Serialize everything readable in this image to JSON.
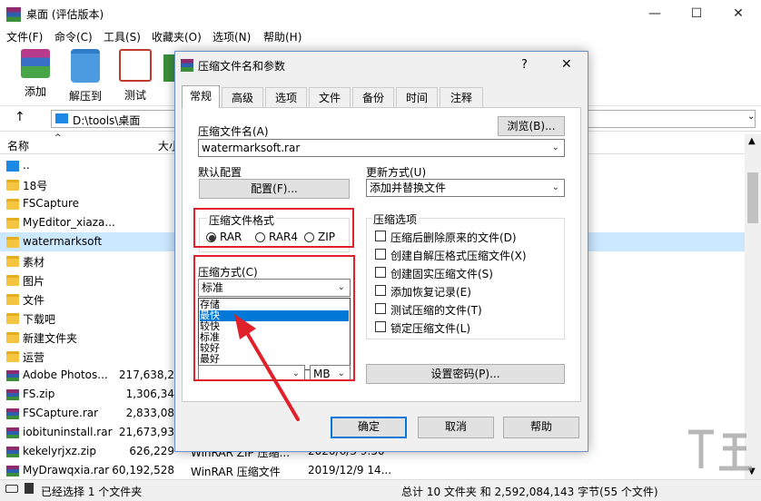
{
  "window": {
    "title": "桌面 (评估版本)",
    "controls": [
      "—",
      "☐",
      "✕"
    ]
  },
  "menu": [
    "文件(F)",
    "命令(C)",
    "工具(S)",
    "收藏夹(O)",
    "选项(N)",
    "帮助(H)"
  ],
  "toolbar": [
    "添加",
    "解压到",
    "测试"
  ],
  "address": "D:\\tools\\桌面",
  "columns": {
    "name": "名称",
    "size": "大小"
  },
  "files": [
    {
      "name": "..",
      "icon": "drive",
      "size": "",
      "type": "",
      "date": ""
    },
    {
      "name": "18号",
      "icon": "folder",
      "size": "",
      "type": "",
      "date": ""
    },
    {
      "name": "FSCapture",
      "icon": "folder",
      "size": "",
      "type": "",
      "date": ""
    },
    {
      "name": "MyEditor_xiaza...",
      "icon": "folder",
      "size": "",
      "type": "",
      "date": ""
    },
    {
      "name": "watermarksoft",
      "icon": "folder-selected",
      "size": "",
      "type": "",
      "date": ""
    },
    {
      "name": "素材",
      "icon": "folder",
      "size": "",
      "type": "",
      "date": ""
    },
    {
      "name": "图片",
      "icon": "folder",
      "size": "",
      "type": "",
      "date": ""
    },
    {
      "name": "文件",
      "icon": "folder",
      "size": "",
      "type": "",
      "date": ""
    },
    {
      "name": "下载吧",
      "icon": "folder",
      "size": "",
      "type": "",
      "date": ""
    },
    {
      "name": "新建文件夹",
      "icon": "folder",
      "size": "",
      "type": "",
      "date": ""
    },
    {
      "name": "运营",
      "icon": "folder",
      "size": "",
      "type": "",
      "date": ""
    },
    {
      "name": "Adobe Photos...",
      "icon": "rar",
      "size": "217,638,2",
      "type": "",
      "date": ""
    },
    {
      "name": "FS.zip",
      "icon": "rar",
      "size": "1,306,34",
      "type": "",
      "date": ""
    },
    {
      "name": "FSCapture.rar",
      "icon": "rar",
      "size": "2,833,08",
      "type": "",
      "date": ""
    },
    {
      "name": "iobituninstall.rar",
      "icon": "rar",
      "size": "21,673,93",
      "type": "",
      "date": ""
    },
    {
      "name": "kekelyrjxz.zip",
      "icon": "rar",
      "size": "626,229",
      "type": "WinRAR ZIP 压缩...",
      "date": "2020/6/3 9:50"
    },
    {
      "name": "MyDrawqxia.rar",
      "icon": "rar",
      "size": "60,192,528",
      "type": "WinRAR 压缩文件",
      "date": "2019/12/9 14..."
    }
  ],
  "status": {
    "left": "已经选择 1 个文件夹",
    "right": "总计 10 文件夹 和 2,592,084,143 字节(55 个文件)"
  },
  "dialog": {
    "title": "压缩文件名和参数",
    "help": "?",
    "close": "✕",
    "tabs": [
      "常规",
      "高级",
      "选项",
      "文件",
      "备份",
      "时间",
      "注释"
    ],
    "archive_name_label": "压缩文件名(A)",
    "browse": "浏览(B)...",
    "archive_name": "watermarksoft.rar",
    "default_profile_label": "默认配置",
    "profile_button": "配置(F)...",
    "update_mode_label": "更新方式(U)",
    "update_mode": "添加并替换文件",
    "format_label": "压缩文件格式",
    "formats": [
      "RAR",
      "RAR4",
      "ZIP"
    ],
    "method_label": "压缩方式(C)",
    "method_value": "标准",
    "method_options": [
      "存储",
      "最快",
      "较快",
      "标准",
      "较好",
      "最好"
    ],
    "split_unit": "MB",
    "options_label": "压缩选项",
    "options": [
      "压缩后删除原来的文件(D)",
      "创建自解压格式压缩文件(X)",
      "创建固实压缩文件(S)",
      "添加恢复记录(E)",
      "测试压缩的文件(T)",
      "锁定压缩文件(L)"
    ],
    "password": "设置密码(P)...",
    "ok": "确定",
    "cancel": "取消",
    "helpbtn": "帮助"
  }
}
